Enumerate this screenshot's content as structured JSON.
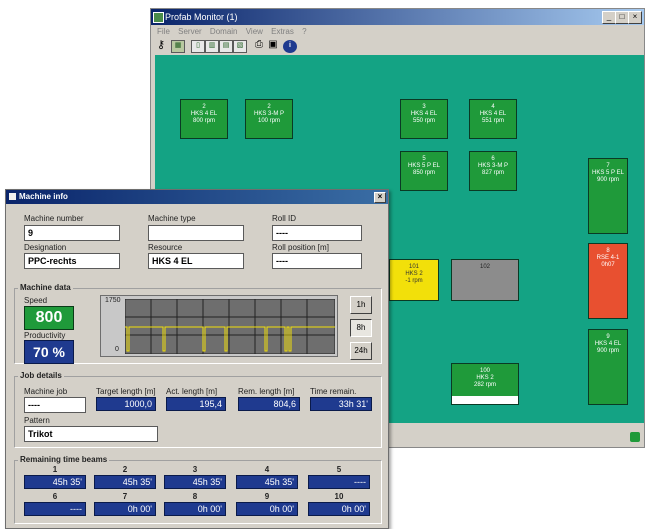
{
  "main_window": {
    "title": "Profab Monitor (1)",
    "menu": [
      "File",
      "Server",
      "Domain",
      "View",
      "Extras",
      "?"
    ],
    "machines": [
      {
        "id": "2",
        "name": "HKS 4 EL",
        "speed": "800 rpm",
        "color": "green"
      },
      {
        "id": "2",
        "name": "HKS 3-M P",
        "speed": "100 rpm",
        "color": "green"
      },
      {
        "id": "3",
        "name": "HKS 4 EL",
        "speed": "550 rpm",
        "color": "green"
      },
      {
        "id": "4",
        "name": "HKS 4 EL",
        "speed": "551 rpm",
        "color": "green"
      },
      {
        "id": "5",
        "name": "HKS 5 P EL",
        "speed": "850 rpm",
        "color": "green"
      },
      {
        "id": "6",
        "name": "HKS 3-M P",
        "speed": "827 rpm",
        "color": "green"
      },
      {
        "id": "7",
        "name": "HKS 5 P EL",
        "speed": "900 rpm",
        "color": "green"
      },
      {
        "id": "101",
        "name": "HKS 2",
        "speed": "-1 rpm",
        "color": "yellow"
      },
      {
        "id": "102",
        "name": "",
        "speed": "",
        "color": "grey"
      },
      {
        "id": "8",
        "name": "RSE 4-1",
        "speed": "0h07",
        "color": "red"
      },
      {
        "id": "9",
        "name": "HKS 4 EL",
        "speed": "900 rpm",
        "color": "green"
      },
      {
        "id": "100",
        "name": "HKS 2",
        "speed": "282 rpm",
        "color": "green"
      }
    ]
  },
  "dialog": {
    "title": "Machine info",
    "machine_number_label": "Machine number",
    "machine_number": "9",
    "machine_type_label": "Machine type",
    "machine_type": "",
    "roll_id_label": "Roll ID",
    "roll_id": "----",
    "designation_label": "Designation",
    "designation": "PPC-rechts",
    "resource_label": "Resource",
    "resource": "HKS 4 EL",
    "roll_position_label": "Roll position [m]",
    "roll_position": "----",
    "machine_data": {
      "title": "Machine data",
      "speed_label": "Speed",
      "speed": "800",
      "productivity_label": "Productivity",
      "productivity": "70 %",
      "chart_ymax": "1750",
      "chart_ymin": "0",
      "buttons": [
        "1h",
        "8h",
        "24h"
      ]
    },
    "job_details": {
      "title": "Job details",
      "machine_job_label": "Machine job",
      "machine_job": "----",
      "target_length_label": "Target length [m]",
      "target_length": "1000,0",
      "act_length_label": "Act. length [m]",
      "act_length": "195,4",
      "rem_length_label": "Rem. length [m]",
      "rem_length": "804,6",
      "time_remain_label": "Time remain.",
      "time_remain": "33h 31'",
      "pattern_label": "Pattern",
      "pattern": "Trikot"
    },
    "beams": {
      "title": "Remaining time beams",
      "row1": [
        {
          "n": "1",
          "v": "45h 35'"
        },
        {
          "n": "2",
          "v": "45h 35'"
        },
        {
          "n": "3",
          "v": "45h 35'"
        },
        {
          "n": "4",
          "v": "45h 35'"
        },
        {
          "n": "5",
          "v": "----"
        }
      ],
      "row2": [
        {
          "n": "6",
          "v": "----"
        },
        {
          "n": "7",
          "v": "0h 00'"
        },
        {
          "n": "8",
          "v": "0h 00'"
        },
        {
          "n": "9",
          "v": "0h 00'"
        },
        {
          "n": "10",
          "v": "0h 00'"
        }
      ]
    }
  }
}
